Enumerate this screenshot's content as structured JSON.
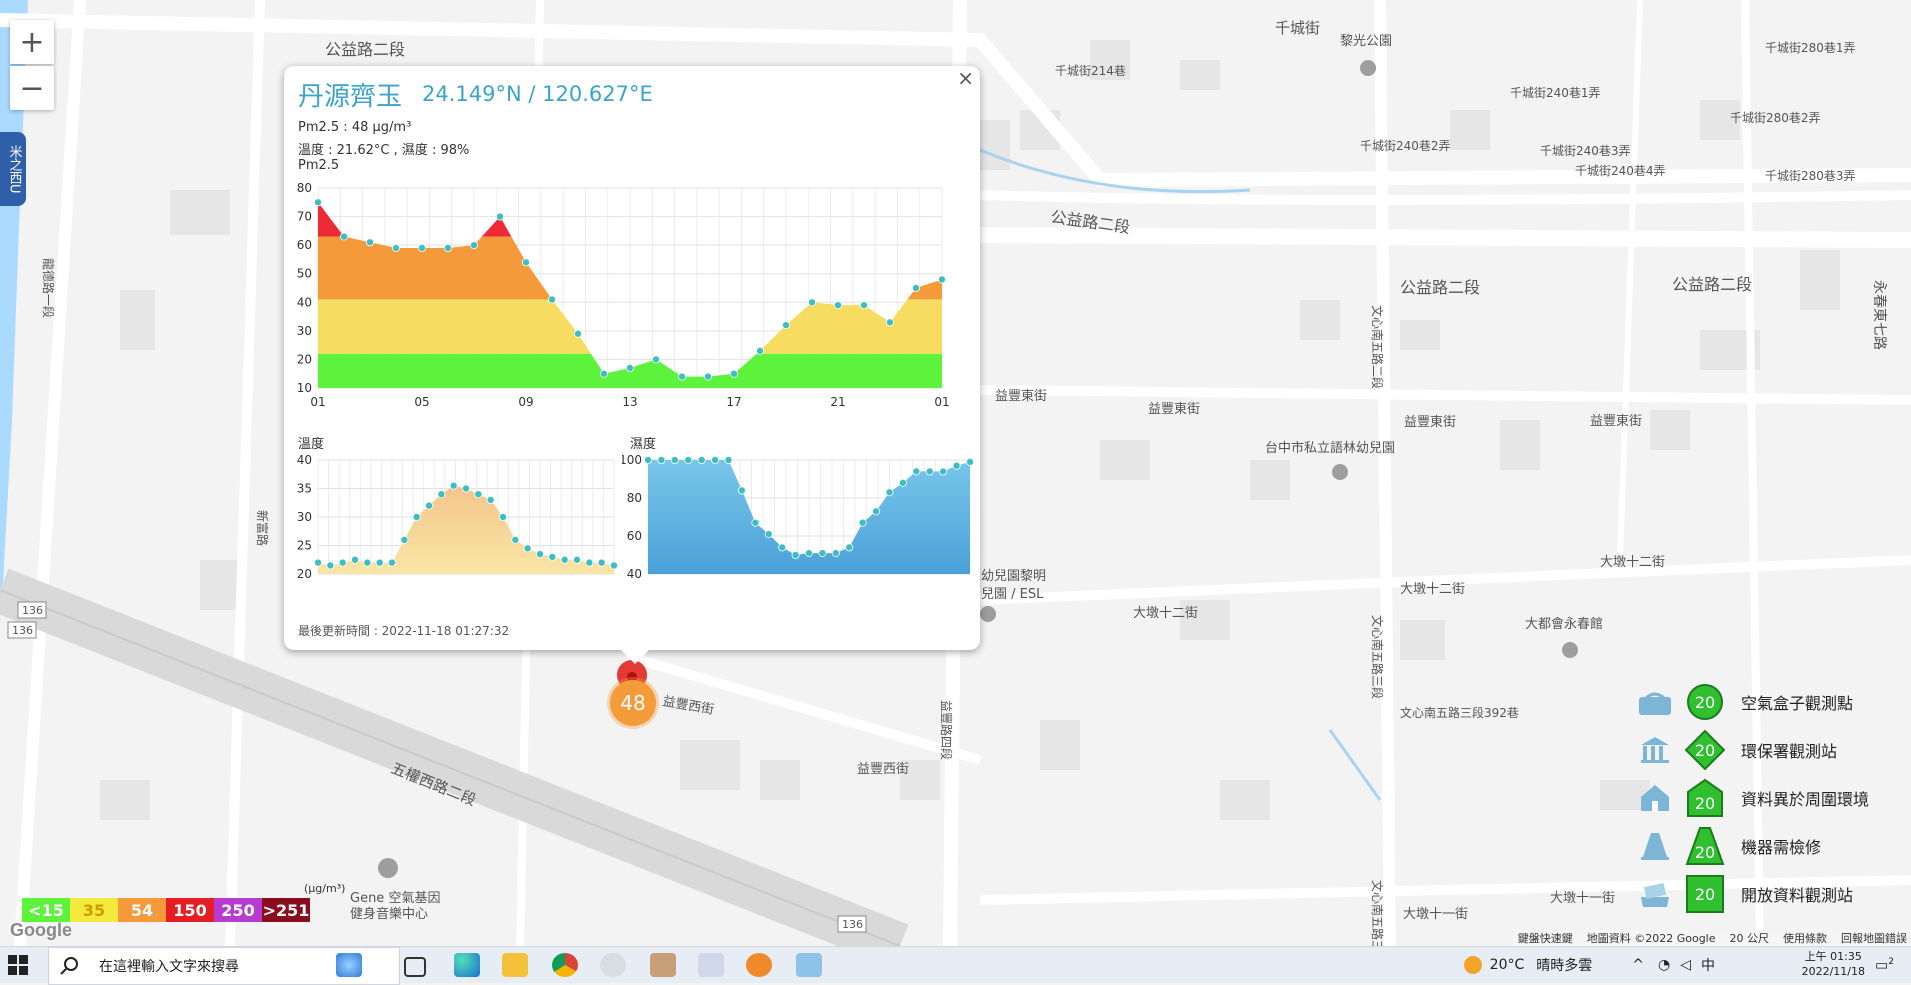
{
  "map": {
    "zoom_in_label": "+",
    "zoom_out_label": "−",
    "side_tab_label": "米之西U",
    "street_labels": [
      {
        "text": "公益路二段",
        "cls": "road"
      },
      {
        "text": "公益路二段",
        "cls": "road"
      },
      {
        "text": "公益路二段",
        "cls": "road"
      },
      {
        "text": "公益路二段",
        "cls": "road"
      },
      {
        "text": "千城街",
        "cls": "road"
      },
      {
        "text": "黎光公園",
        "cls": "poi"
      },
      {
        "text": "千城街214巷",
        "cls": "small"
      },
      {
        "text": "千城街240巷1弄",
        "cls": "small"
      },
      {
        "text": "千城街240巷2弄",
        "cls": "small"
      },
      {
        "text": "千城街240巷3弄",
        "cls": "small"
      },
      {
        "text": "千城街240巷4弄",
        "cls": "small"
      },
      {
        "text": "千城街280巷1弄",
        "cls": "small"
      },
      {
        "text": "千城街280巷2弄",
        "cls": "small"
      },
      {
        "text": "千城街280巷3弄",
        "cls": "small"
      },
      {
        "text": "益豐東街",
        "cls": "road"
      },
      {
        "text": "益豐東街",
        "cls": "road"
      },
      {
        "text": "益豐東街",
        "cls": "road"
      },
      {
        "text": "益豐東街",
        "cls": "road"
      },
      {
        "text": "台中市私立語林幼兒園",
        "cls": "poi"
      },
      {
        "text": "大墩十二街",
        "cls": "road"
      },
      {
        "text": "大墩十二街",
        "cls": "road"
      },
      {
        "text": "大墩十二街",
        "cls": "road"
      },
      {
        "text": "大都會永春館",
        "cls": "poi"
      },
      {
        "text": "文心南五路三段392巷",
        "cls": "small"
      },
      {
        "text": "益豐西街",
        "cls": "road"
      },
      {
        "text": "益豐西街",
        "cls": "road"
      },
      {
        "text": "五權西路二段",
        "cls": "road"
      },
      {
        "text": "大墩十一街",
        "cls": "road"
      },
      {
        "text": "大墩十一街",
        "cls": "road"
      },
      {
        "text": "幼兒園黎明",
        "cls": "poi"
      },
      {
        "text": "兒園 / ESL",
        "cls": "poi"
      },
      {
        "text": "Gene 空氣基因",
        "cls": "poi"
      },
      {
        "text": "健身音樂中心",
        "cls": "poi"
      },
      {
        "text": "文心南五路二段",
        "cls": "road"
      },
      {
        "text": "文心南五路三段",
        "cls": "road"
      },
      {
        "text": "文心南五路三段",
        "cls": "road"
      },
      {
        "text": "益豐路四段",
        "cls": "road"
      },
      {
        "text": "永春東七路",
        "cls": "road"
      },
      {
        "text": "新富路",
        "cls": "road"
      },
      {
        "text": "龍德路一段",
        "cls": "road"
      },
      {
        "text": "136",
        "cls": "shield"
      },
      {
        "text": "136",
        "cls": "shield"
      },
      {
        "text": "136",
        "cls": "shield"
      }
    ]
  },
  "popup": {
    "close_label": "×",
    "title": "丹源齊玉",
    "coords": "24.149°N / 120.627°E",
    "pm25_line": "Pm2.5 : 48 μg/m³",
    "temp_humidity_line": "溫度 : 21.62°C , 濕度 : 98%",
    "pm_chart_label": "Pm2.5",
    "temp_chart_label": "溫度",
    "humidity_chart_label": "濕度",
    "updated": "最後更新時間 : 2022-11-18 01:27:32"
  },
  "chart_data": [
    {
      "type": "area",
      "title": "Pm2.5",
      "x_tick_labels": [
        "01",
        "05",
        "09",
        "13",
        "17",
        "21",
        "01"
      ],
      "y_ticks": [
        "10",
        "20",
        "30",
        "40",
        "50",
        "60",
        "70",
        "80"
      ],
      "ylim": [
        10,
        80
      ],
      "grid": true,
      "bands": [
        {
          "max": 22,
          "color": "#5df23c"
        },
        {
          "max": 41,
          "color": "#f6dc60"
        },
        {
          "max": 63,
          "color": "#f59a3a"
        },
        {
          "max": 80,
          "color": "#ee2a36"
        }
      ],
      "values": [
        75,
        63,
        61,
        59,
        59,
        59,
        60,
        70,
        54,
        41,
        29,
        15,
        17,
        20,
        14,
        14,
        15,
        23,
        32,
        40,
        39,
        39,
        33,
        45,
        48
      ]
    },
    {
      "type": "area",
      "title": "溫度",
      "y_ticks": [
        "20",
        "25",
        "30",
        "35",
        "40"
      ],
      "ylim": [
        20,
        40
      ],
      "grid": true,
      "fill_top": "#f4c58c",
      "fill_bottom": "#f9e6a6",
      "values": [
        22,
        21.5,
        22,
        22.5,
        22,
        22,
        22,
        26,
        30,
        32,
        34,
        35.5,
        35,
        34,
        33,
        30,
        26,
        24.5,
        23.5,
        23,
        22.5,
        22.5,
        22,
        22,
        21.5
      ]
    },
    {
      "type": "area",
      "title": "濕度",
      "y_ticks": [
        "40",
        "60",
        "80",
        "100"
      ],
      "ylim": [
        40,
        100
      ],
      "grid": true,
      "fill_top": "#79c6ea",
      "fill_bottom": "#4aa0d8",
      "values": [
        100,
        100,
        100,
        100,
        100,
        100,
        100,
        84,
        67,
        61,
        54,
        50,
        51,
        51,
        51,
        54,
        67,
        73,
        83,
        88,
        94,
        94,
        94,
        97,
        99
      ]
    }
  ],
  "marker": {
    "value": "48",
    "color": "#f49b3a"
  },
  "legend": {
    "items": [
      {
        "label": "空氣盒子觀測點",
        "badge": "20",
        "shape": "circle",
        "icon": "airbox-icon"
      },
      {
        "label": "環保署觀測站",
        "badge": "20",
        "shape": "diamond",
        "icon": "government-building-icon"
      },
      {
        "label": "資料異於周圍環境",
        "badge": "20",
        "shape": "house",
        "icon": "home-icon"
      },
      {
        "label": "機器需檢修",
        "badge": "20",
        "shape": "cone",
        "icon": "traffic-cone-icon"
      },
      {
        "label": "開放資料觀測站",
        "badge": "20",
        "shape": "square",
        "icon": "open-data-icon"
      }
    ]
  },
  "aqi_scale": {
    "unit": "(μg/m³)",
    "cells": [
      {
        "label": "<15",
        "color": "#5df23c"
      },
      {
        "label": "35",
        "color": "#f4ea3c"
      },
      {
        "label": "54",
        "color": "#f59a3a"
      },
      {
        "label": "150",
        "color": "#e41e23"
      },
      {
        "label": "250",
        "color": "#b63bd0"
      },
      {
        "label": ">251",
        "color": "#8a0d1e"
      }
    ]
  },
  "attribution": {
    "google": "Google",
    "shortcuts": "鍵盤快速鍵",
    "map_data": "地圖資料 ©2022 Google",
    "scale": "20 公尺",
    "terms": "使用條款",
    "report": "回報地圖錯誤"
  },
  "taskbar": {
    "search_placeholder": "在這裡輸入文字來搜尋",
    "weather_temp": "20°C",
    "weather_desc": "晴時多雲",
    "ime": "中",
    "time": "上午 01:35",
    "date": "2022/11/18",
    "notification_count": "2"
  }
}
